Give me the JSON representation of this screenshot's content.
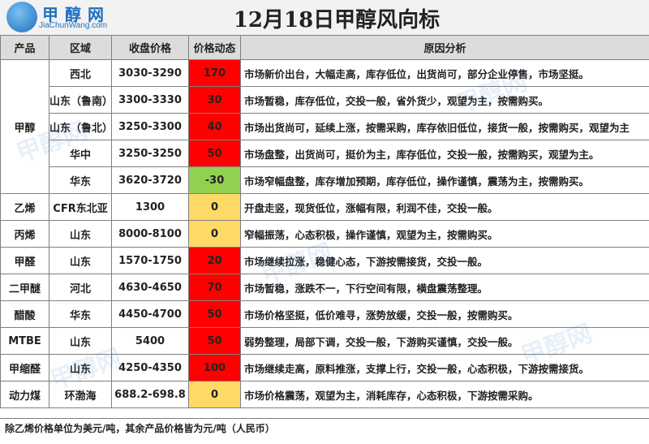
{
  "logo": {
    "name_cn": "甲醇网",
    "name_en": "JiaChunWang.com"
  },
  "title": "12月18日甲醇风向标",
  "headers": {
    "product": "产品",
    "region": "区域",
    "price": "收盘价格",
    "change": "价格动态",
    "analysis": "原因分析"
  },
  "rows": [
    {
      "product": "甲醇",
      "region": "西北",
      "price": "3030-3290",
      "change": "170",
      "analysis": "市场新价出台，大幅走高，库存低位，出货尚可，部分企业停售，市场坚挺。"
    },
    {
      "product": "",
      "region": "山东（鲁南）",
      "price": "3300-3330",
      "change": "30",
      "analysis": "市场暂稳，库存低位，交投一般，省外货少，观望为主，按需购买。"
    },
    {
      "product": "",
      "region": "山东（鲁北）",
      "price": "3250-3300",
      "change": "40",
      "analysis": "市场出货尚可，延续上涨，按需采购，库存依旧低位，接货一般，按需购买，观望为主"
    },
    {
      "product": "",
      "region": "华中",
      "price": "3250-3250",
      "change": "50",
      "analysis": "市场盘整，出货尚可，挺价为主，库存低位，交投一般，按需购买，观望为主。"
    },
    {
      "product": "",
      "region": "华东",
      "price": "3620-3720",
      "change": "-30",
      "analysis": "市场窄幅盘整，库存增加预期，库存低位，操作谨慎，震荡为主，按需购买。"
    },
    {
      "product": "乙烯",
      "region": "CFR东北亚",
      "price": "1300",
      "change": "0",
      "analysis": "开盘走竖，现货低位，涨幅有限，利润不佳，交投一般。"
    },
    {
      "product": "丙烯",
      "region": "山东",
      "price": "8000-8100",
      "change": "0",
      "analysis": "窄幅振荡，心态积极，操作谨慎，观望为主，按需购买。"
    },
    {
      "product": "甲醛",
      "region": "山东",
      "price": "1570-1750",
      "change": "20",
      "analysis": "市场继续拉涨，稳健心态，下游按需接货，交投一般。"
    },
    {
      "product": "二甲醚",
      "region": "河北",
      "price": "4630-4650",
      "change": "70",
      "analysis": "市场暂稳，涨跌不一，下行空间有限，横盘震荡整理。"
    },
    {
      "product": "醋酸",
      "region": "华东",
      "price": "4450-4700",
      "change": "50",
      "analysis": "市场价格坚挺，低价难寻，涨势放缓，交投一般，按需购买。"
    },
    {
      "product": "MTBE",
      "region": "山东",
      "price": "5400",
      "change": "50",
      "analysis": "弱势整理，局部下调，交投一般，下游购买谨慎，交投一般。"
    },
    {
      "product": "甲缩醛",
      "region": "山东",
      "price": "4250-4350",
      "change": "100",
      "analysis": "市场继续走高，原料推涨，支撑上行，交投一般，心态积极，下游按需接货。"
    },
    {
      "product": "动力煤",
      "region": "环渤海",
      "price": "688.2-698.8",
      "change": "0",
      "analysis": "市场价格震荡，观望为主，消耗库存，心态积极，下游按需采购。"
    }
  ],
  "footer": "除乙烯价格单位为美元/吨，其余产品价格皆为元/吨（人民币）",
  "colors": {
    "up": "#ff0000",
    "down": "#92d050",
    "flat": "#ffd966",
    "header_bg": "#dcdcdc"
  }
}
